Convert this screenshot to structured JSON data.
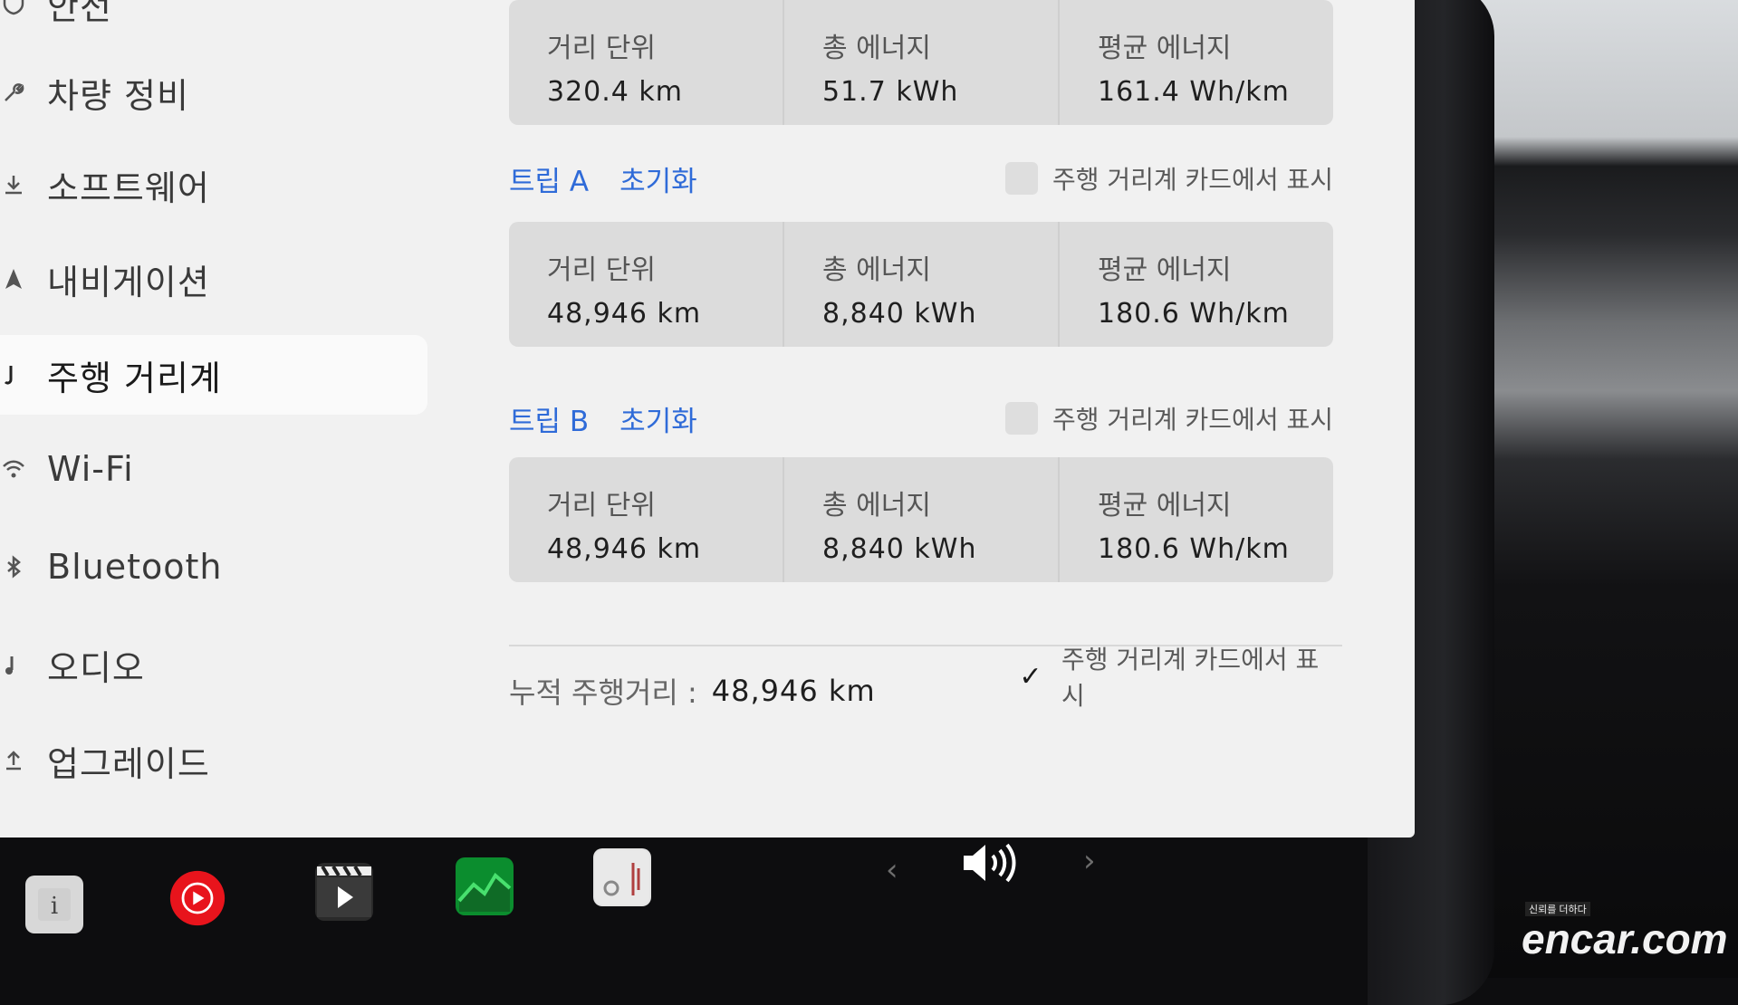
{
  "sidebar": {
    "items": [
      {
        "label": "안전",
        "icon": "shield-icon"
      },
      {
        "label": "차량 정비",
        "icon": "wrench-icon"
      },
      {
        "label": "소프트웨어",
        "icon": "download-icon"
      },
      {
        "label": "내비게이션",
        "icon": "navigation-icon"
      },
      {
        "label": "주행 거리계",
        "icon": "odometer-icon",
        "active": true
      },
      {
        "label": "Wi-Fi",
        "icon": "wifi-icon"
      },
      {
        "label": "Bluetooth",
        "icon": "bluetooth-icon"
      },
      {
        "label": "오디오",
        "icon": "audio-icon"
      },
      {
        "label": "업그레이드",
        "icon": "upgrade-icon"
      }
    ]
  },
  "since_last_charge": {
    "distance_label": "거리 단위",
    "distance_value": "320.4 km",
    "energy_label": "총 에너지",
    "energy_value": "51.7 kWh",
    "avg_label": "평균 에너지",
    "avg_value": "161.4 Wh/km"
  },
  "trip_a": {
    "name": "트립 A",
    "reset_label": "초기화",
    "show_label": "주행 거리계 카드에서 표시",
    "show_checked": false,
    "distance_label": "거리 단위",
    "distance_value": "48,946 km",
    "energy_label": "총 에너지",
    "energy_value": "8,840 kWh",
    "avg_label": "평균 에너지",
    "avg_value": "180.6 Wh/km"
  },
  "trip_b": {
    "name": "트립 B",
    "reset_label": "초기화",
    "show_label": "주행 거리계 카드에서 표시",
    "show_checked": false,
    "distance_label": "거리 단위",
    "distance_value": "48,946 km",
    "energy_label": "총 에너지",
    "energy_value": "8,840 kWh",
    "avg_label": "평균 에너지",
    "avg_value": "180.6 Wh/km"
  },
  "odometer": {
    "label": "누적 주행거리 :",
    "value": "48,946 km",
    "show_label": "주행 거리계 카드에서 표시",
    "show_checked": true,
    "check_glyph": "✓"
  },
  "dock": {
    "icons": [
      "manual-icon",
      "youtube-music-icon",
      "theater-icon",
      "energy-chart-icon",
      "dashcam-viewer-icon"
    ],
    "prev_glyph": "‹",
    "next_glyph": "›"
  },
  "watermark": {
    "text": "encar.com",
    "tagline": "신뢰를 더하다"
  },
  "colors": {
    "accent": "#2f6bd8",
    "screen_bg": "#f1f1f1",
    "panel_bg": "#dcdcdc"
  }
}
